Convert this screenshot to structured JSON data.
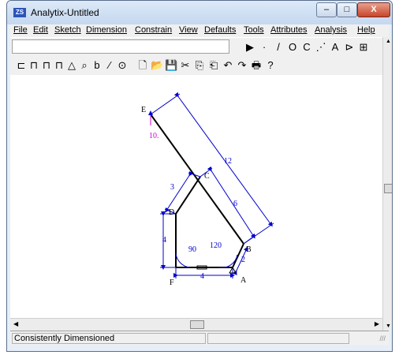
{
  "window": {
    "title": "Analytix-Untitled",
    "icon_label": "ZS"
  },
  "titlebar_buttons": {
    "minimize": "–",
    "maximize": "□",
    "close": "X"
  },
  "menu": [
    "File",
    "Edit",
    "Sketch",
    "Dimension",
    "Constrain",
    "View",
    "Defaults",
    "Tools",
    "Attributes",
    "Analysis",
    "Help"
  ],
  "toolbar_right_icons": [
    "▶",
    "·",
    "/",
    "O",
    "C",
    "⋰",
    "A",
    "⊳",
    "⊞"
  ],
  "toolbar2_icons": [
    "⊏",
    "⊓",
    "⊓",
    "⊓",
    "△",
    "⌕",
    "b",
    "⁄",
    "⊙",
    "🗋",
    "📂",
    "💾",
    "✂",
    "⎘",
    "⎗",
    "↶",
    "↷",
    "🖶",
    "?"
  ],
  "drawing": {
    "point_labels": [
      "E",
      "C",
      "D",
      "B",
      "A",
      "F"
    ],
    "dimension_labels": [
      "12",
      "6",
      "3",
      "4",
      "90",
      "120",
      "2",
      "4",
      "10."
    ]
  },
  "status": {
    "message": "Consistently Dimensioned",
    "grip": "///"
  }
}
